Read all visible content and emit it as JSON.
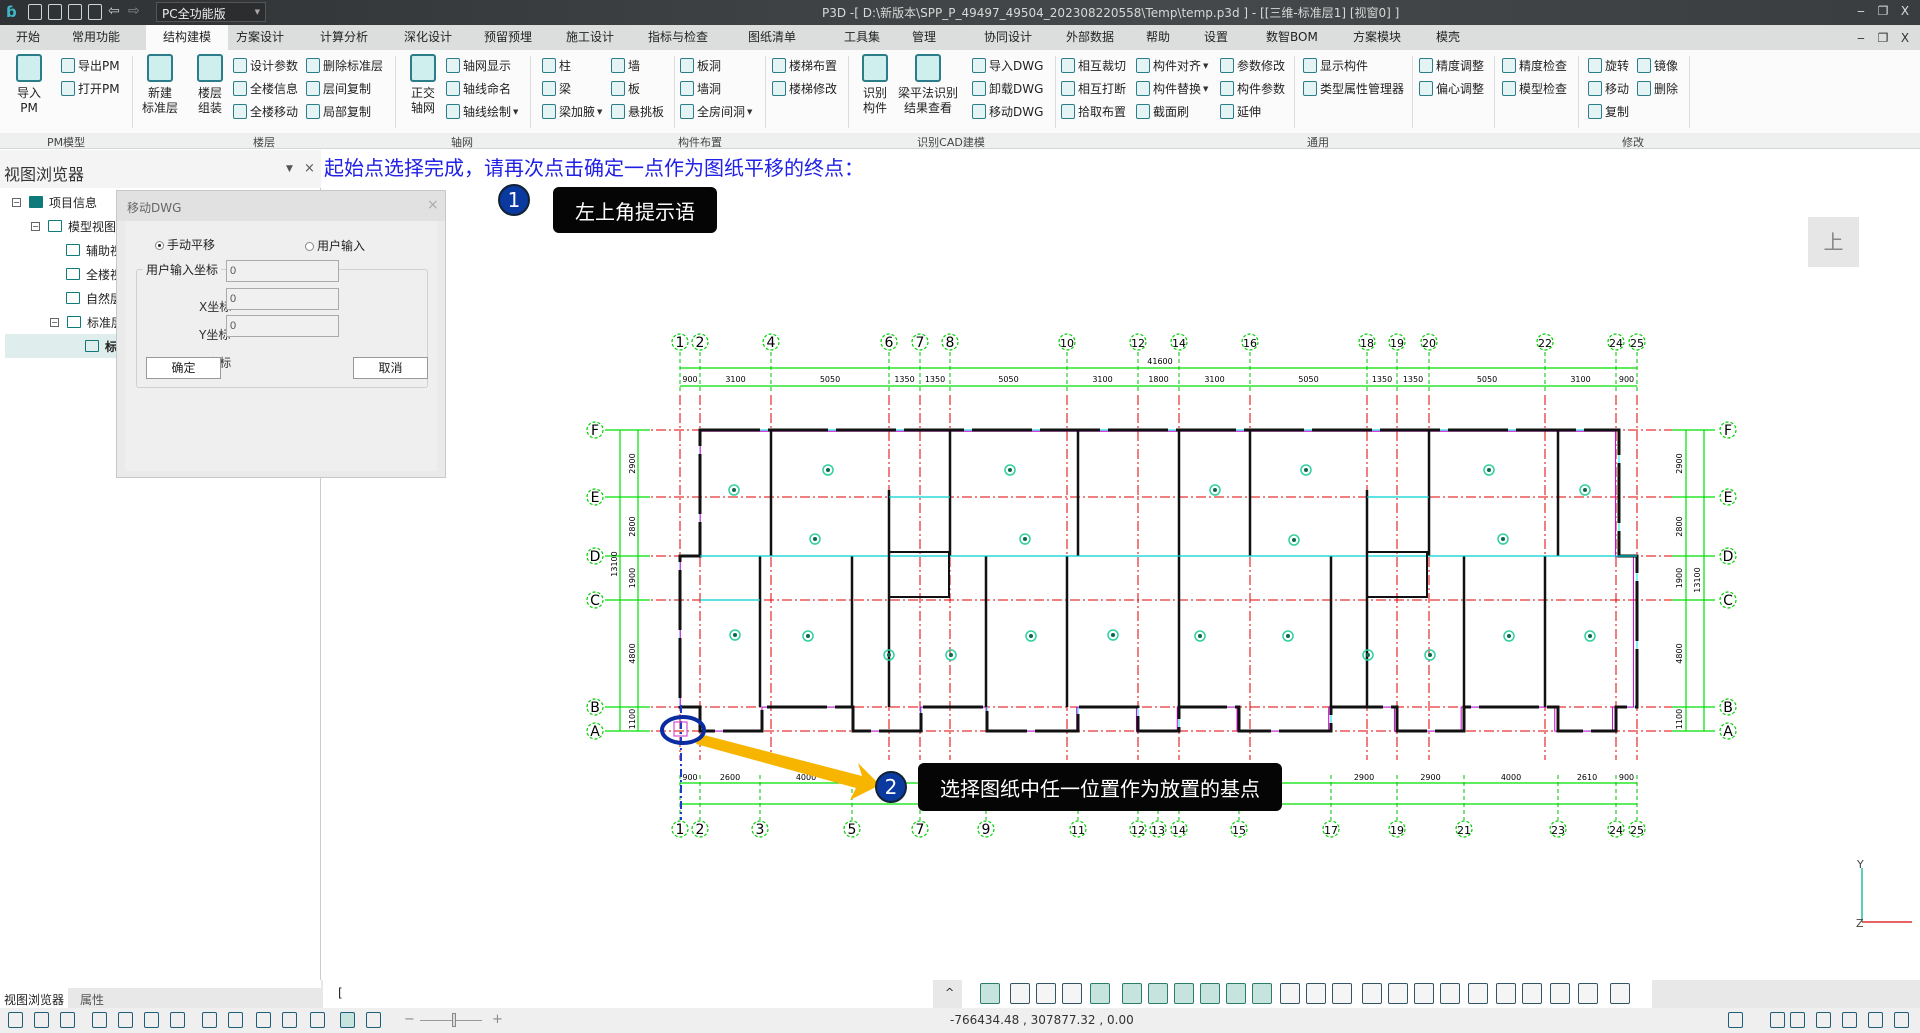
{
  "titlebar": {
    "version_select": "PC全功能版",
    "title": "P3D -[ D:\\新版本\\SPP_P_49497_49504_202308220558\\Temp\\temp.p3d ] - [[三维-标准层1]  [视窗0]  ]",
    "min": "‒",
    "restore": "❐",
    "close": "X"
  },
  "menu_tabs": [
    "开始",
    "常用功能",
    "结构建模",
    "方案设计",
    "计算分析",
    "深化设计",
    "预留预埋",
    "施工设计",
    "指标与检查",
    "图纸清单",
    "工具集",
    "管理",
    "协同设计",
    "外部数据",
    "帮助",
    "设置",
    "数智BOM",
    "方案模块",
    "模壳"
  ],
  "active_tab": "结构建模",
  "ribbon": {
    "groups": [
      "PM模型",
      "楼层",
      "轴网",
      "构件布置",
      "识别CAD建模",
      "通用",
      "修改"
    ],
    "columns": [
      {
        "large": [
          "导入",
          "PM"
        ]
      },
      {
        "items": [
          "导出PM",
          "打开PM"
        ]
      },
      {
        "large": [
          "新建",
          "标准层"
        ]
      },
      {
        "large": [
          "楼层",
          "组装"
        ]
      },
      {
        "items": [
          "设计参数",
          "全楼信息",
          "全楼移动"
        ]
      },
      {
        "items": [
          "删除标准层",
          "层间复制",
          "局部复制"
        ]
      },
      {
        "large": [
          "正交",
          "轴网"
        ]
      },
      {
        "items": [
          "轴网显示",
          "轴线命名",
          "轴线绘制"
        ],
        "dropdown": [
          2
        ]
      },
      {
        "items": [
          "柱",
          "梁",
          "梁加腋"
        ],
        "dropdown": [
          2
        ]
      },
      {
        "items": [
          "墙",
          "板",
          "悬挑板"
        ]
      },
      {
        "items": [
          "板洞",
          "墙洞",
          "全房间洞"
        ],
        "dropdown": [
          2
        ]
      },
      {
        "items": [
          "楼梯布置",
          "楼梯修改"
        ]
      },
      {
        "large": [
          "识别",
          "构件"
        ]
      },
      {
        "large": [
          "梁平法识别",
          "结果查看"
        ]
      },
      {
        "items": [
          "导入DWG",
          "卸载DWG",
          "移动DWG"
        ]
      },
      {
        "items": [
          "相互裁切",
          "相互打断",
          "拾取布置"
        ]
      },
      {
        "items": [
          "构件对齐",
          "构件替换",
          "截面刷"
        ],
        "dropdown": [
          0,
          1
        ]
      },
      {
        "items": [
          "参数修改",
          "构件参数",
          "延伸"
        ]
      },
      {
        "items": [
          "显示构件",
          "类型属性管理器"
        ]
      },
      {
        "items": [
          "精度调整",
          "偏心调整"
        ]
      },
      {
        "items": [
          "精度检查",
          "模型检查"
        ]
      },
      {
        "items": [
          "旋转",
          "移动",
          "复制"
        ]
      },
      {
        "items": [
          "镜像",
          "删除"
        ]
      }
    ]
  },
  "left_panel": {
    "title": "视图浏览器",
    "tree": [
      "项目信息",
      "模型视图",
      "辅助视",
      "全楼视",
      "自然层",
      "标准层",
      "标"
    ],
    "bottom_tabs": [
      "视图浏览器",
      "属性"
    ]
  },
  "dialog": {
    "title": "移动DWG",
    "radio_manual": "手动平移",
    "radio_user": "用户输入",
    "fieldset_label": "用户输入坐标",
    "x_label": "X坐标",
    "x_value": "0",
    "y_label": "Y坐标",
    "y_value": "0",
    "z_label": "Z坐标",
    "z_value": "0",
    "ok": "确定",
    "cancel": "取消",
    "selected_mode": "手动平移"
  },
  "canvas": {
    "prompt": "起始点选择完成，请再次点击确定一点作为图纸平移的终点：",
    "callout1_num": "1",
    "callout1_text": "左上角提示语",
    "callout2_num": "2",
    "callout2_text": "选择图纸中任一位置作为放置的基点",
    "view_cube_label": "上",
    "axis_y": "Y",
    "axis_z": "Z"
  },
  "drawing": {
    "top_axes": [
      "1",
      "2",
      "4",
      "6",
      "7",
      "8",
      "10",
      "12",
      "14",
      "16",
      "18",
      "19",
      "20",
      "22",
      "24",
      "25"
    ],
    "top_dims": [
      "900",
      "3100",
      "5050",
      "1350",
      "1350",
      "5050",
      "3100",
      "1800",
      "3100",
      "5050",
      "1350",
      "1350",
      "5050",
      "3100",
      "900"
    ],
    "top_total": "41600",
    "bottom_axes": [
      "1",
      "2",
      "3",
      "5",
      "7",
      "9",
      "11",
      "12",
      "13",
      "14",
      "15",
      "17",
      "19",
      "21",
      "23",
      "24",
      "25"
    ],
    "bottom_dims": [
      [
        "1",
        "2",
        "900"
      ],
      [
        "2",
        "3",
        "2600"
      ],
      [
        "3",
        "5",
        "4000"
      ],
      [
        "17",
        "19",
        "2900"
      ],
      [
        "19",
        "21",
        "2900"
      ],
      [
        "21",
        "23",
        "4000"
      ],
      [
        "23",
        "24",
        "2610"
      ],
      [
        "24",
        "25",
        "900"
      ]
    ],
    "row_axes": [
      "F",
      "E",
      "D",
      "C",
      "B",
      "A"
    ],
    "row_dims": [
      "2900",
      "2800",
      "1900",
      "4800",
      "1100"
    ],
    "row_total": "13100"
  },
  "command": {
    "input_value": "["
  },
  "status": {
    "coordinates": "-766434.48 , 307877.32 , 0.00"
  }
}
